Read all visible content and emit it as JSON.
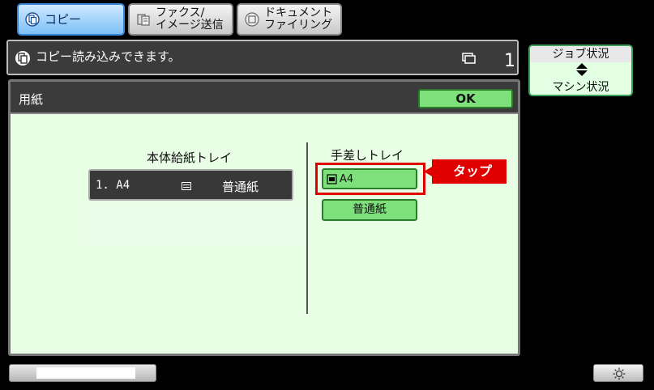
{
  "tabs": {
    "copy": "コピー",
    "fax_line1": "ファクス/",
    "fax_line2": "イメージ送信",
    "doc_line1": "ドキュメント",
    "doc_line2": "ファイリング"
  },
  "status": {
    "message": "コピー読み込みできます。",
    "count": "1"
  },
  "job_button": {
    "top": "ジョブ状況",
    "bottom": "マシン状況"
  },
  "paper_dialog": {
    "title": "用紙",
    "ok_label": "OK",
    "main_tray_label": "本体給紙トレイ",
    "main_tray_number": "1. A4",
    "main_tray_type": "普通紙",
    "bypass_label": "手差しトレイ",
    "bypass_size": "A4",
    "bypass_type": "普通紙"
  },
  "callout": "タップ",
  "colors": {
    "accent_green": "#7de07a",
    "panel_bg": "#e9ffe5",
    "callout_red": "#e00000",
    "header_dark": "#3b3b3b"
  }
}
